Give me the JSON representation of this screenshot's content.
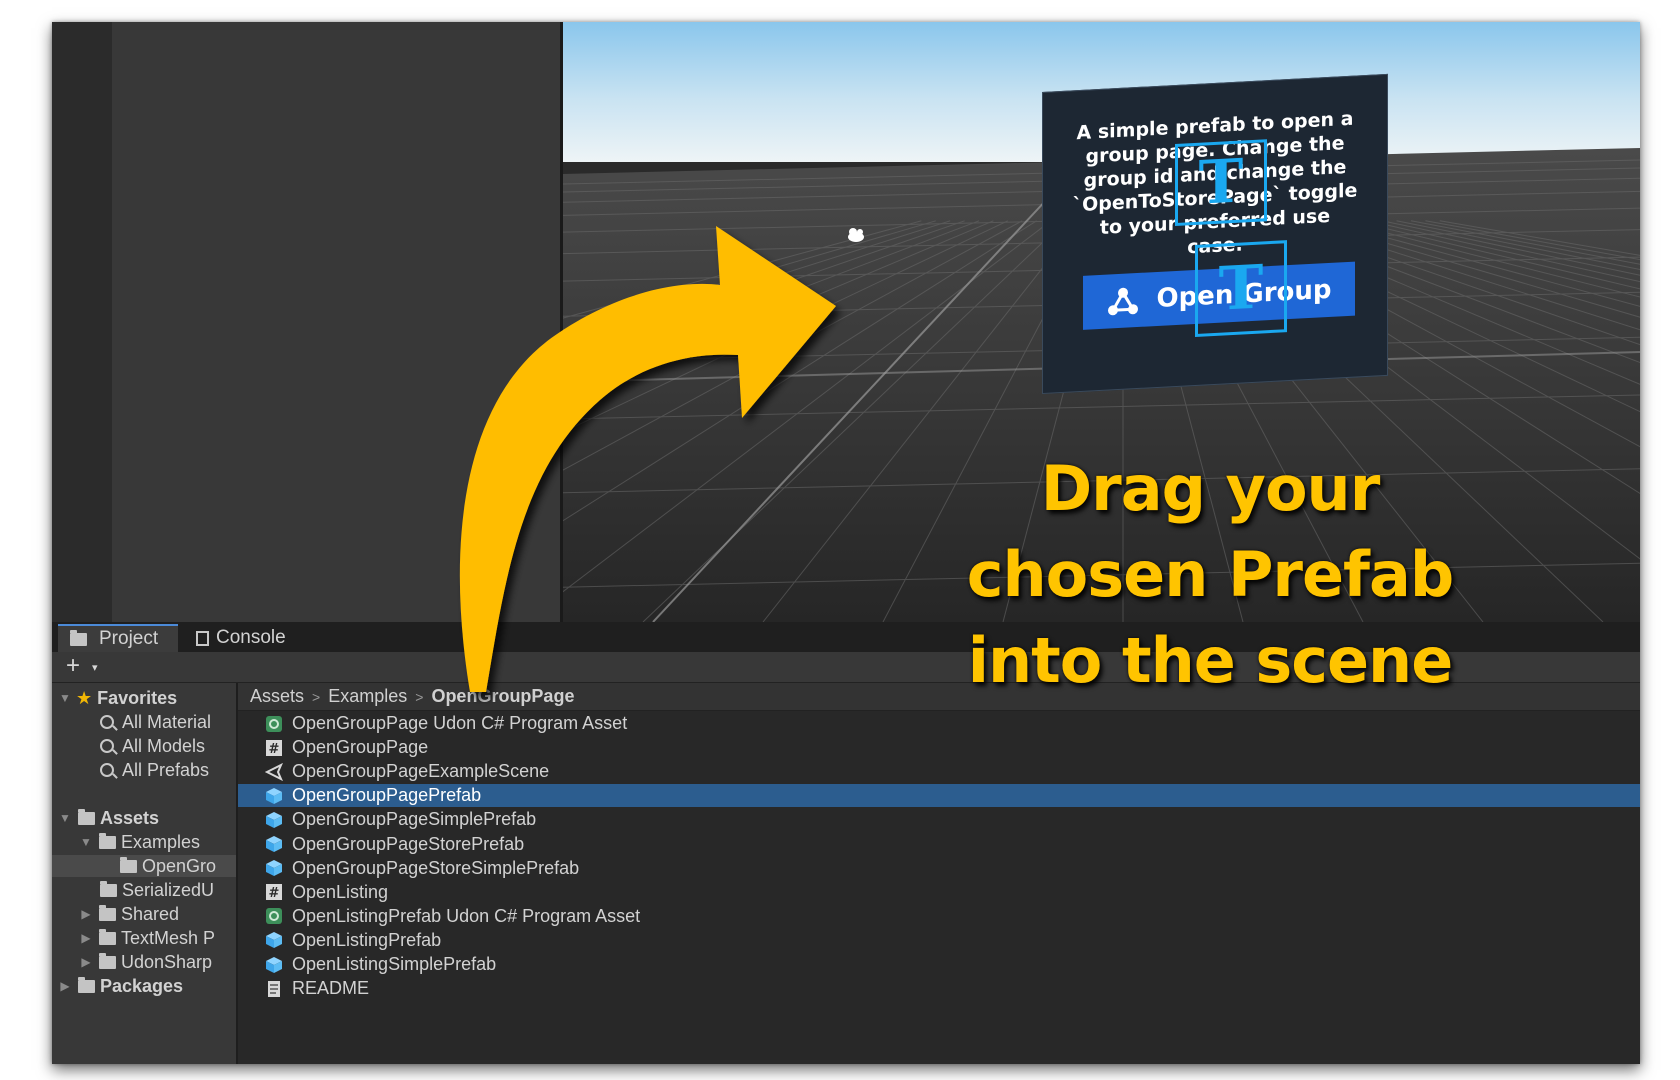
{
  "scene_panel": {
    "description": "A simple prefab to open a group page. Change the group id and change the `OpenToStorePage` toggle to your preferred use case.",
    "button_label": "Open Group",
    "gizmo_letter": "T"
  },
  "tabs": [
    {
      "label": "Project",
      "icon": "folder-icon",
      "active": true
    },
    {
      "label": "Console",
      "icon": "console-icon",
      "active": false
    }
  ],
  "toolbar": {
    "add_label": "+",
    "add_caret": "▾"
  },
  "tree": {
    "favorites_label": "Favorites",
    "favorites": [
      "All Material",
      "All Models",
      "All Prefabs"
    ],
    "assets_label": "Assets",
    "examples_label": "Examples",
    "opengroup_label": "OpenGro",
    "serialized_label": "SerializedU",
    "shared_label": "Shared",
    "textmesh_label": "TextMesh P",
    "udonsharp_label": "UdonSharp",
    "packages_label": "Packages"
  },
  "breadcrumb": {
    "root": "Assets",
    "mid": "Examples",
    "current": "OpenGroupPage",
    "separator": ">"
  },
  "files": [
    {
      "name": "OpenGroupPage Udon C# Program Asset",
      "icon": "udon-asset-icon"
    },
    {
      "name": "OpenGroupPage",
      "icon": "script-icon"
    },
    {
      "name": "OpenGroupPageExampleScene",
      "icon": "unity-scene-icon"
    },
    {
      "name": "OpenGroupPagePrefab",
      "icon": "prefab-icon"
    },
    {
      "name": "OpenGroupPageSimplePrefab",
      "icon": "prefab-icon"
    },
    {
      "name": "OpenGroupPageStorePrefab",
      "icon": "prefab-icon"
    },
    {
      "name": "OpenGroupPageStoreSimplePrefab",
      "icon": "prefab-icon"
    },
    {
      "name": "OpenListing",
      "icon": "script-icon"
    },
    {
      "name": "OpenListingPrefab Udon C# Program Asset",
      "icon": "udon-asset-icon"
    },
    {
      "name": "OpenListingPrefab",
      "icon": "prefab-icon"
    },
    {
      "name": "OpenListingSimplePrefab",
      "icon": "prefab-icon"
    },
    {
      "name": "README",
      "icon": "text-document-icon"
    }
  ],
  "selected_file": "OpenGroupPagePrefab",
  "callout": {
    "line1": "Drag your",
    "line2": "chosen Prefab",
    "line3": "into the scene"
  },
  "colors": {
    "callout_yellow": "#ffc400",
    "selection_blue": "#2c5d8f",
    "ui_button_blue": "#1f67d6",
    "gizmo_cyan": "#1aa8f0"
  }
}
